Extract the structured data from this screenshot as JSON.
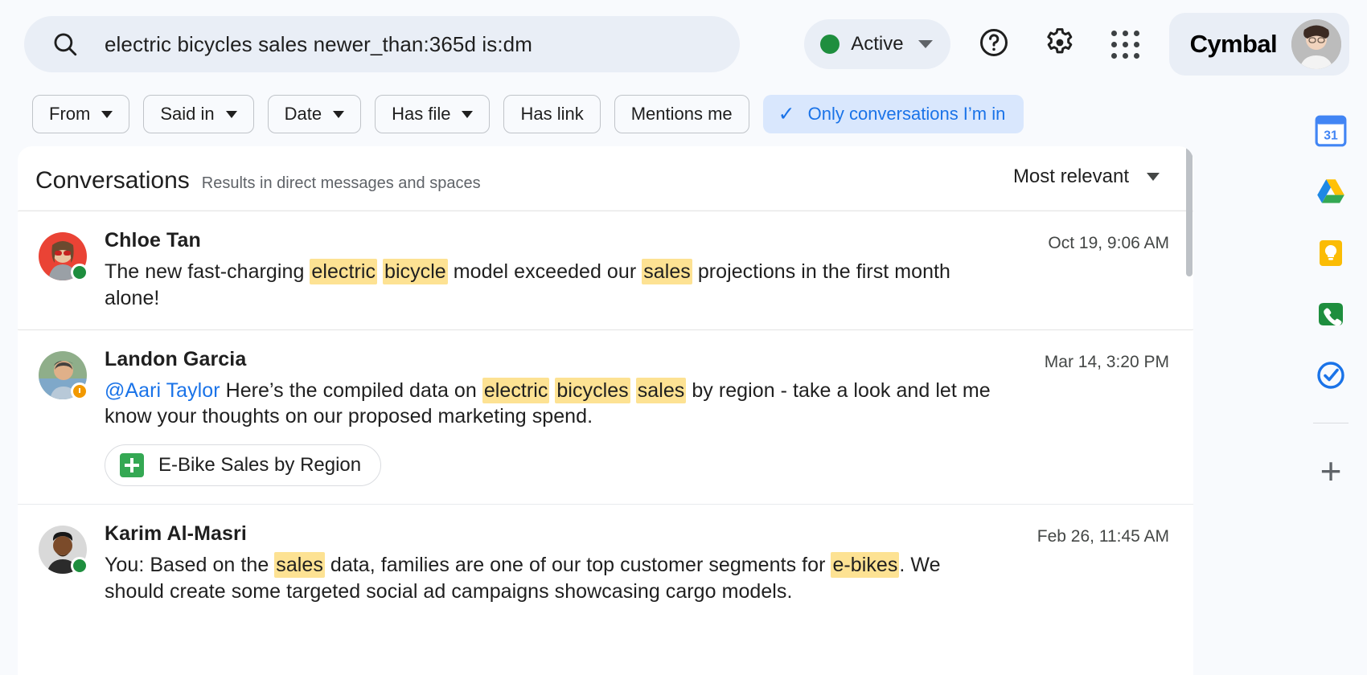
{
  "header": {
    "search": {
      "icon": "search-icon",
      "value": "electric bicycles sales newer_than:365d is:dm",
      "placeholder": "Search"
    },
    "status": {
      "label": "Active",
      "dot_color": "#1e8e3e",
      "icon": "chevron-down-icon"
    },
    "help_icon": "help-icon",
    "settings_icon": "gear-icon",
    "apps_icon": "apps-grid-icon",
    "brand": {
      "name": "Cymbal",
      "avatar": "user-avatar"
    }
  },
  "filters": [
    {
      "label": "From",
      "has_caret": true,
      "active": false
    },
    {
      "label": "Said in",
      "has_caret": true,
      "active": false
    },
    {
      "label": "Date",
      "has_caret": true,
      "active": false
    },
    {
      "label": "Has file",
      "has_caret": true,
      "active": false
    },
    {
      "label": "Has link",
      "has_caret": false,
      "active": false
    },
    {
      "label": "Mentions me",
      "has_caret": false,
      "active": false
    },
    {
      "label": "Only conversations I’m in",
      "has_caret": false,
      "active": true,
      "check": "✓"
    }
  ],
  "results_panel": {
    "title": "Conversations",
    "subtitle": "Results in direct messages and spaces",
    "sort": {
      "label": "Most relevant",
      "icon": "chevron-down-icon"
    },
    "items": [
      {
        "name": "Chloe Tan",
        "time": "Oct 19, 9:06 AM",
        "presence": "online",
        "avatar_color": "#ea4335",
        "selected": true,
        "segments": [
          {
            "t": "The new fast-charging ",
            "hl": false
          },
          {
            "t": "electric",
            "hl": true
          },
          {
            "t": " ",
            "hl": false
          },
          {
            "t": "bicycle",
            "hl": true
          },
          {
            "t": " model exceeded our ",
            "hl": false
          },
          {
            "t": "sales",
            "hl": true
          },
          {
            "t": " projections in the first month alone!",
            "hl": false
          }
        ]
      },
      {
        "name": "Landon Garcia",
        "time": "Mar 14, 3:20 PM",
        "presence": "away",
        "avatar_color": "#7aa6c2",
        "selected": false,
        "segments": [
          {
            "t": "@Aari Taylor",
            "mention": true
          },
          {
            "t": " Here’s the compiled data on ",
            "hl": false
          },
          {
            "t": "electric",
            "hl": true
          },
          {
            "t": " ",
            "hl": false
          },
          {
            "t": "bicycles",
            "hl": true
          },
          {
            "t": " ",
            "hl": false
          },
          {
            "t": "sales",
            "hl": true
          },
          {
            "t": " by region - take a look and let me know your thoughts on our proposed marketing spend.",
            "hl": false
          }
        ],
        "attachment": {
          "label": "E-Bike Sales by Region",
          "icon": "google-sheets-icon"
        }
      },
      {
        "name": "Karim Al-Masri",
        "time": "Feb 26, 11:45 AM",
        "presence": "online",
        "avatar_color": "#5d4037",
        "selected": false,
        "segments": [
          {
            "t": "You: Based on the ",
            "hl": false
          },
          {
            "t": "sales",
            "hl": true
          },
          {
            "t": " data, families are one of our top customer segments for ",
            "hl": false
          },
          {
            "t": "e-bikes",
            "hl": true
          },
          {
            "t": ". We should create some targeted social ad campaigns showcasing cargo models.",
            "hl": false
          }
        ]
      }
    ]
  },
  "right_rail": [
    {
      "icon": "google-calendar-icon",
      "label": "Calendar",
      "badge": "31"
    },
    {
      "icon": "google-drive-icon",
      "label": "Drive"
    },
    {
      "icon": "google-keep-icon",
      "label": "Keep"
    },
    {
      "icon": "google-voice-icon",
      "label": "Voice"
    },
    {
      "icon": "google-tasks-icon",
      "label": "Tasks"
    },
    {
      "icon": "plus-icon",
      "label": "Add"
    }
  ],
  "colors": {
    "accent_blue": "#1a73e8",
    "chip_active_bg": "#d9e7fd",
    "highlight": "#fde293",
    "page_bg": "#f8fafd",
    "online_green": "#1e8e3e",
    "away_orange": "#f29900"
  }
}
